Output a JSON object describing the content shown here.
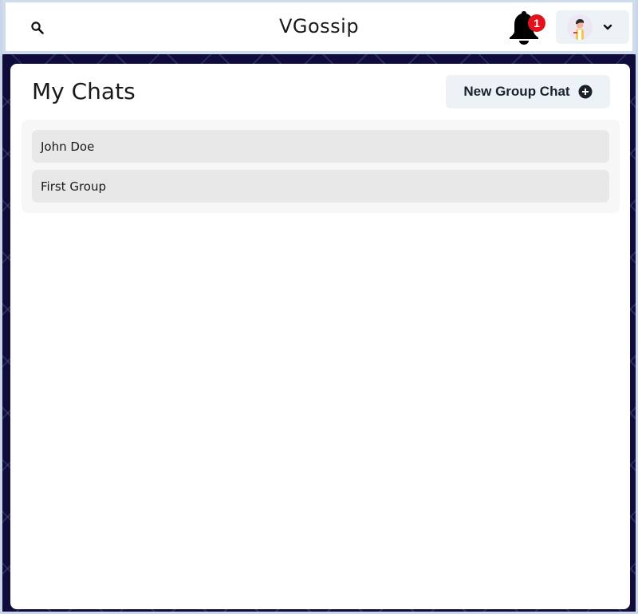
{
  "header": {
    "app_title": "VGossip",
    "search_icon": "search-icon",
    "notifications": {
      "icon": "bell-icon",
      "badge_count": "1",
      "badge_color": "#e3131d"
    },
    "profile": {
      "avatar_icon": "avatar",
      "dropdown_icon": "chevron-down-icon"
    }
  },
  "panel": {
    "title": "My Chats",
    "new_group_button": {
      "label": "New Group Chat",
      "icon": "plus-circle-icon"
    },
    "chats": [
      {
        "name": "John Doe"
      },
      {
        "name": "First Group"
      }
    ]
  },
  "colors": {
    "background": "#0f0b3a",
    "button_bg": "#edf2f7",
    "chat_item_bg": "#e8e8e8"
  }
}
